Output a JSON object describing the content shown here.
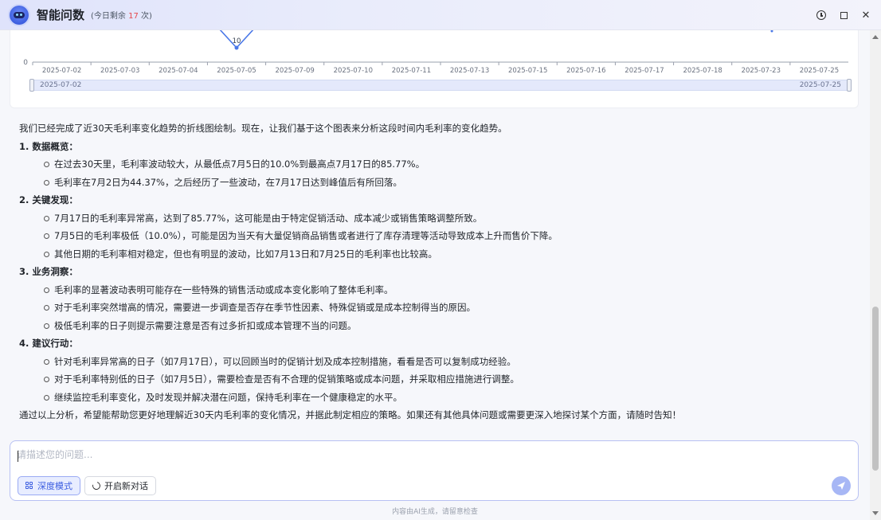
{
  "window": {
    "title": "智能问数",
    "quota_prefix": "(今日剩余 ",
    "quota_count": "17",
    "quota_suffix": " 次)"
  },
  "chart_data": {
    "type": "line",
    "categories": [
      "2025-07-02",
      "2025-07-03",
      "2025-07-04",
      "2025-07-05",
      "2025-07-09",
      "2025-07-10",
      "2025-07-11",
      "2025-07-13",
      "2025-07-15",
      "2025-07-16",
      "2025-07-17",
      "2025-07-18",
      "2025-07-23",
      "2025-07-25"
    ],
    "y_tick_visible": "0",
    "visible_point_label": "10",
    "visible_point_category": "2025-07-05",
    "zoom_start_label": "2025-07-02",
    "zoom_end_label": "2025-07-25",
    "line_color": "#4a78e8"
  },
  "answer": {
    "intro": "我们已经完成了近30天毛利率变化趋势的折线图绘制。现在，让我们基于这个图表来分析这段时间内毛利率的变化趋势。",
    "sections": [
      {
        "heading": "1. 数据概览：",
        "items": [
          "在过去30天里，毛利率波动较大，从最低点7月5日的10.0%到最高点7月17日的85.77%。",
          "毛利率在7月2日为44.37%，之后经历了一些波动，在7月17日达到峰值后有所回落。"
        ]
      },
      {
        "heading": "2. 关键发现：",
        "items": [
          "7月17日的毛利率异常高，达到了85.77%，这可能是由于特定促销活动、成本减少或销售策略调整所致。",
          "7月5日的毛利率极低（10.0%），可能是因为当天有大量促销商品销售或者进行了库存清理等活动导致成本上升而售价下降。",
          "其他日期的毛利率相对稳定，但也有明显的波动，比如7月13日和7月25日的毛利率也比较高。"
        ]
      },
      {
        "heading": "3. 业务洞察：",
        "items": [
          "毛利率的显著波动表明可能存在一些特殊的销售活动或成本变化影响了整体毛利率。",
          "对于毛利率突然增高的情况，需要进一步调查是否存在季节性因素、特殊促销或是成本控制得当的原因。",
          "极低毛利率的日子则提示需要注意是否有过多折扣或成本管理不当的问题。"
        ]
      },
      {
        "heading": "4. 建议行动：",
        "items": [
          "针对毛利率异常高的日子（如7月17日），可以回顾当时的促销计划及成本控制措施，看看是否可以复制成功经验。",
          "对于毛利率特别低的日子（如7月5日），需要检查是否有不合理的促销策略或成本问题，并采取相应措施进行调整。",
          "继续监控毛利率变化，及时发现并解决潜在问题，保持毛利率在一个健康稳定的水平。"
        ]
      }
    ],
    "outro": "通过以上分析，希望能帮助您更好地理解近30天内毛利率的变化情况，并据此制定相应的策略。如果还有其他具体问题或需要更深入地探讨某个方面，请随时告知！"
  },
  "composer": {
    "placeholder": "请描述您的问题...",
    "deep_mode_label": "深度模式",
    "new_chat_label": "开启新对话"
  },
  "footer": {
    "note": "内容由AI生成，请留意检查"
  },
  "colors": {
    "accent": "#3a5ce0",
    "quota_count": "#e5484d"
  }
}
